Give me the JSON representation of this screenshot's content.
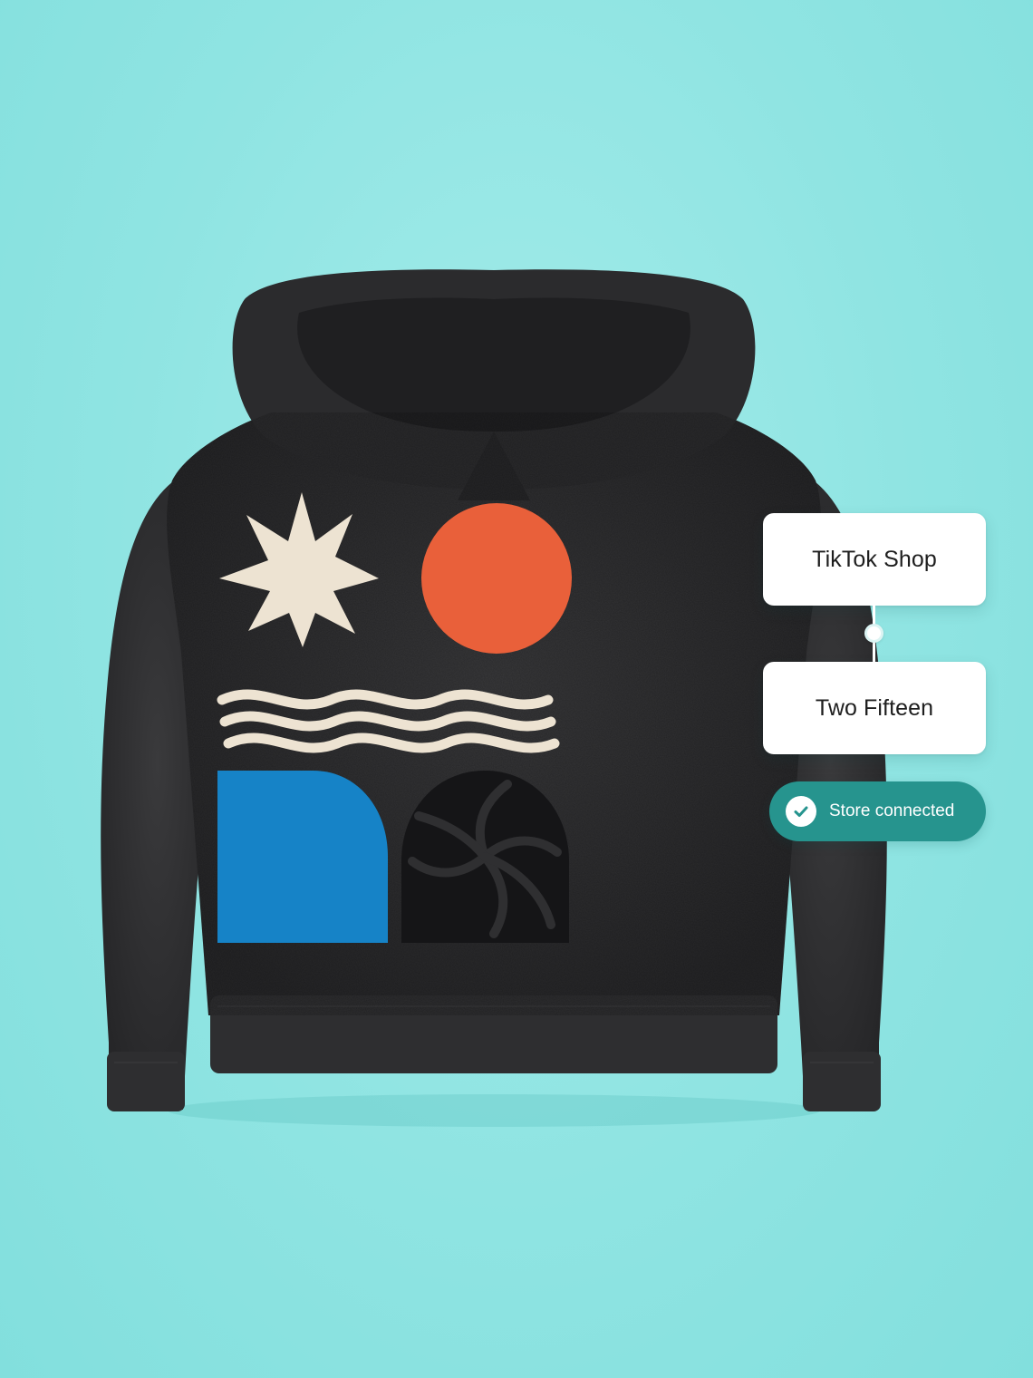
{
  "flow": {
    "source_label": "TikTok Shop",
    "store_label": "Two Fifteen",
    "status_label": "Store connected"
  },
  "icons": {
    "status": "check-circle-icon",
    "connector": "connector-dot-icon"
  },
  "product": {
    "image": "hoodie-with-abstract-print"
  },
  "colors": {
    "background": "#8fe4e2",
    "status_pill": "#26948e",
    "hoodie": "#2f2f31",
    "sun_orange": "#e9603a",
    "star_cream": "#ede3d2",
    "quarter_blue": "#1683c7"
  }
}
